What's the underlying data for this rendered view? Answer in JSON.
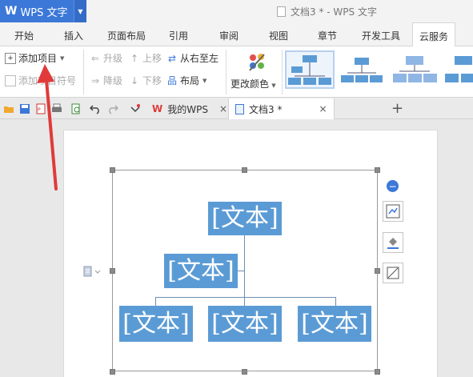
{
  "app": {
    "logo": "W",
    "name": "WPS 文字",
    "window_title": "文档3 * - WPS 文字"
  },
  "ribbon_tabs": [
    {
      "label": "开始"
    },
    {
      "label": "插入"
    },
    {
      "label": "页面布局"
    },
    {
      "label": "引用"
    },
    {
      "label": "审阅"
    },
    {
      "label": "视图"
    },
    {
      "label": "章节"
    },
    {
      "label": "开发工具"
    },
    {
      "label": "云服务"
    }
  ],
  "ribbon": {
    "add_item": "添加项目",
    "add_bullet": "添加项目符号",
    "promote": "升级",
    "demote": "降级",
    "move_up": "上移",
    "move_down": "下移",
    "right_to_left": "从右至左",
    "layout": "布局",
    "change_colors": "更改颜色",
    "layout_gallery": [
      {
        "name": "org-chart-standard",
        "selected": true
      },
      {
        "name": "org-chart-name-title",
        "selected": false
      },
      {
        "name": "org-chart-half-circle",
        "selected": false
      },
      {
        "name": "org-chart-hierarchy",
        "selected": false
      }
    ]
  },
  "doc_tabs": [
    {
      "label": "我的WPS",
      "close": "×"
    },
    {
      "label": "文档3 *",
      "close": "×"
    }
  ],
  "new_tab": "+",
  "smartart": {
    "nodes": [
      {
        "text": "[文本]"
      },
      {
        "text": "[文本]"
      },
      {
        "text": "[文本]"
      },
      {
        "text": "[文本]"
      },
      {
        "text": "[文本]"
      }
    ]
  },
  "colors": {
    "brand": "#3c78d8",
    "node_fill": "#5b9bd5",
    "annotation_arrow": "#e03a3a"
  }
}
